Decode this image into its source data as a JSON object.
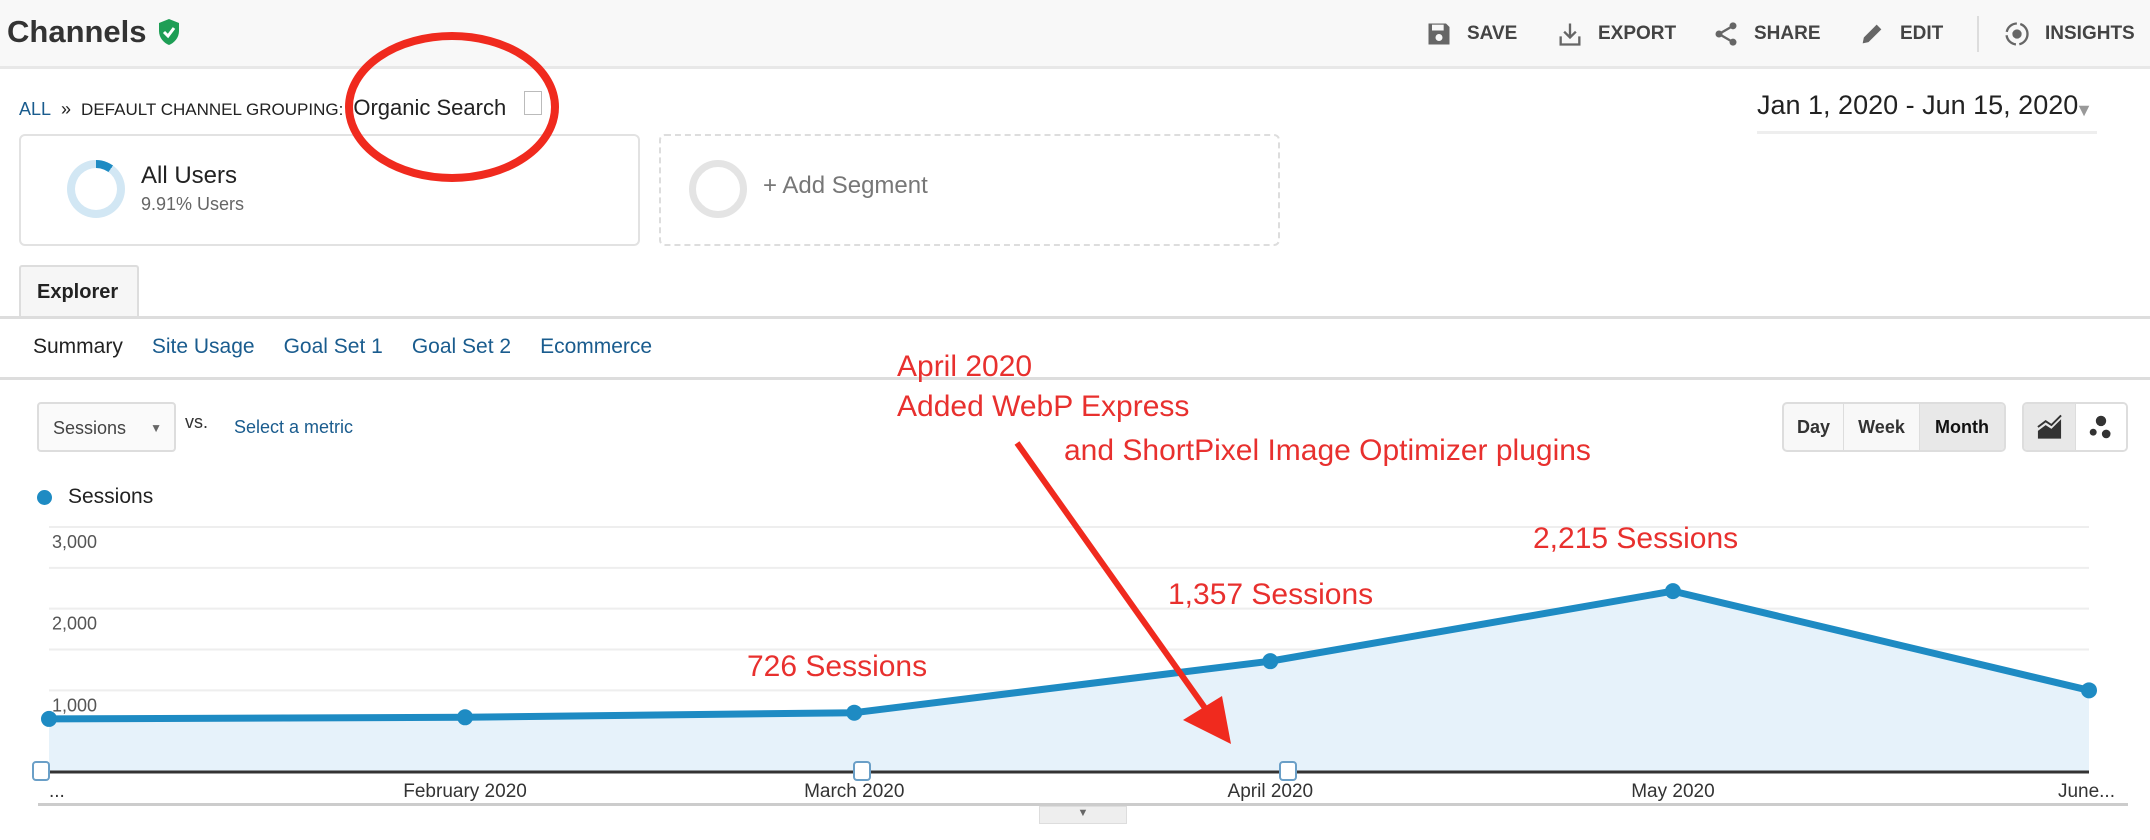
{
  "header": {
    "title": "Channels",
    "actions": [
      {
        "label": "SAVE",
        "icon": "save-icon"
      },
      {
        "label": "EXPORT",
        "icon": "export-icon"
      },
      {
        "label": "SHARE",
        "icon": "share-icon"
      },
      {
        "label": "EDIT",
        "icon": "edit-icon"
      },
      {
        "label": "INSIGHTS",
        "icon": "insights-icon"
      }
    ]
  },
  "breadcrumb": {
    "root": "ALL",
    "sep": "»",
    "group": "DEFAULT CHANNEL GROUPING:",
    "value": "Organic Search"
  },
  "date_range": "Jan 1, 2020 - Jun 15, 2020",
  "segments": {
    "active": {
      "name": "All Users",
      "detail": "9.91% Users",
      "share": 0.0991
    },
    "add": "+ Add Segment"
  },
  "tab": "Explorer",
  "subtabs": [
    "Summary",
    "Site Usage",
    "Goal Set 1",
    "Goal Set 2",
    "Ecommerce"
  ],
  "metric": {
    "selected": "Sessions",
    "vs": "vs.",
    "select_metric": "Select a metric"
  },
  "granularity": {
    "options": [
      "Day",
      "Week",
      "Month"
    ],
    "selected": "Month"
  },
  "chart_types": [
    "line-chart-icon",
    "motion-chart-icon"
  ],
  "colors": {
    "series": "#1e8bc3",
    "fill": "#e6f2fa",
    "annotation": "#e8302e",
    "link": "#1a5c8e"
  },
  "annotations": {
    "note_lines": [
      "April 2020",
      "Added WebP Express",
      "and ShortPixel Image Optimizer plugins"
    ],
    "labels": [
      "726 Sessions",
      "1,357 Sessions",
      "2,215 Sessions"
    ]
  },
  "chart_data": {
    "type": "area",
    "legend": "Sessions",
    "x": [
      "2020-01-01",
      "2020-02-01",
      "2020-03-01",
      "2020-04-01",
      "2020-05-01",
      "2020-06-01"
    ],
    "x_tick_labels": [
      "...",
      "February 2020",
      "March 2020",
      "April 2020",
      "May 2020",
      "June..."
    ],
    "series": [
      {
        "name": "Sessions",
        "values": [
          650,
          670,
          726,
          1357,
          2215,
          1000
        ]
      }
    ],
    "yticks": [
      "1,000",
      "2,000",
      "3,000"
    ],
    "ylim": [
      0,
      3000
    ],
    "grid": true
  }
}
